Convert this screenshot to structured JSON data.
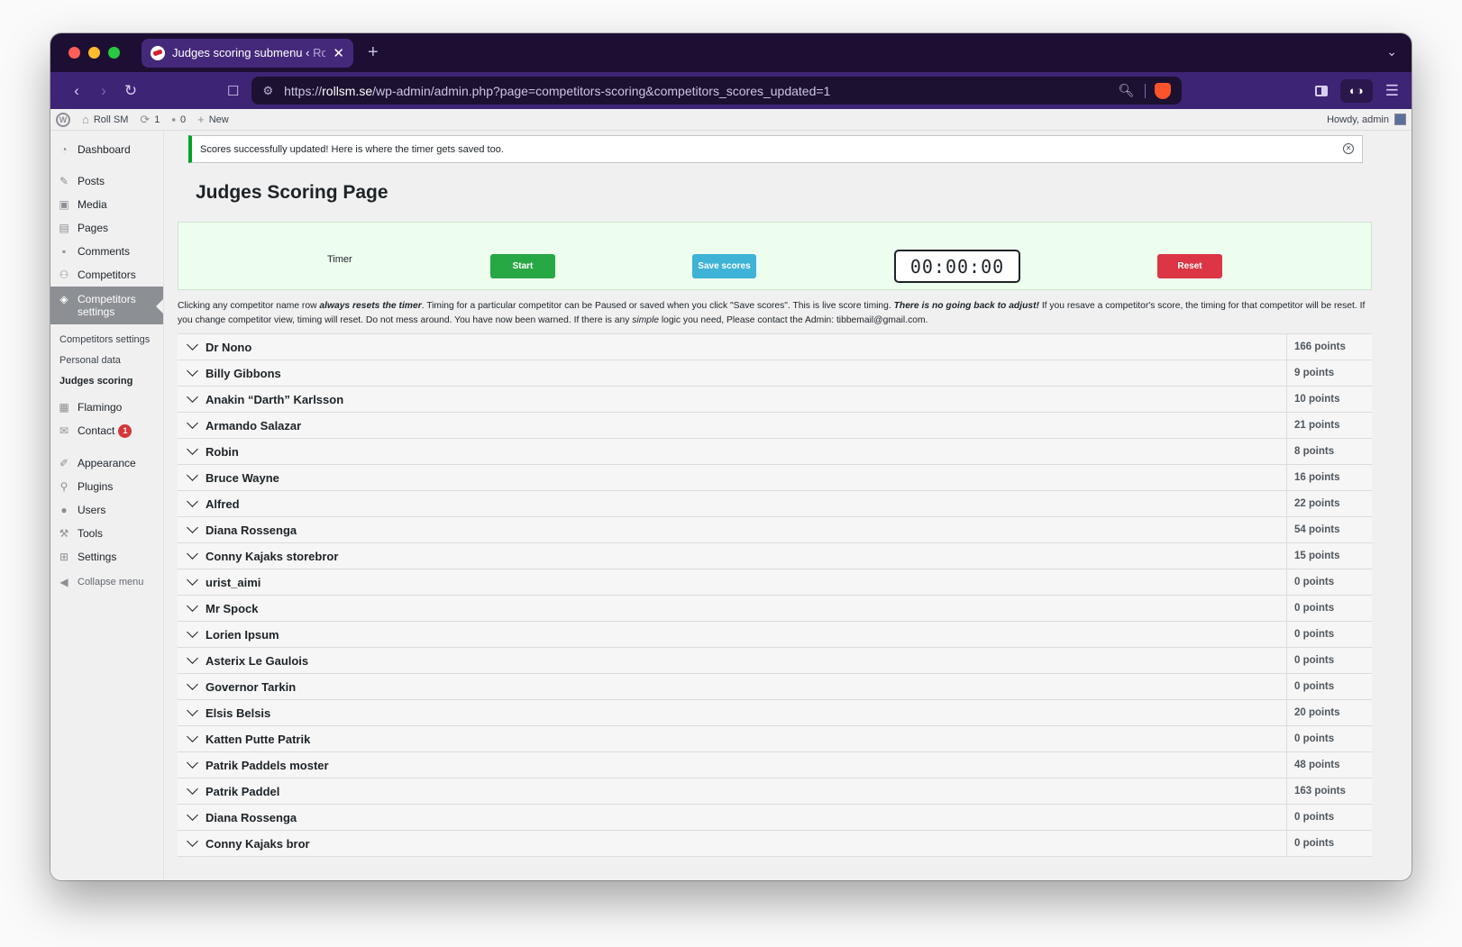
{
  "colors": {
    "tabbar": "#1d0f33",
    "navbar": "#3e2475",
    "start": "#28a745",
    "save": "#3eb3d6",
    "reset": "#dc3545",
    "notice_accent": "#00a32a",
    "traffic": [
      "#ff5f57",
      "#febc2e",
      "#28c840"
    ]
  },
  "browser": {
    "tab_title_main": "Judges scoring submenu ‹ ",
    "tab_title_fade": "Ro",
    "url_scheme": "https://",
    "url_host": "rollsm.se",
    "url_path": "/wp-admin/admin.php?page=competitors-scoring&competitors_scores_updated=1"
  },
  "adminbar": {
    "site": "Roll SM",
    "updates": "1",
    "comments": "0",
    "new": "New",
    "howdy": "Howdy, admin"
  },
  "menu": {
    "dashboard": "Dashboard",
    "posts": "Posts",
    "media": "Media",
    "pages": "Pages",
    "comments": "Comments",
    "competitors": "Competitors",
    "competitors_settings_line1": "Competitors",
    "competitors_settings_line2": "settings",
    "sub_competitors_settings": "Competitors settings",
    "sub_personal_data": "Personal data",
    "sub_judges_scoring": "Judges scoring",
    "flamingo": "Flamingo",
    "contact": "Contact",
    "contact_badge": "1",
    "appearance": "Appearance",
    "plugins": "Plugins",
    "users": "Users",
    "tools": "Tools",
    "settings": "Settings",
    "collapse": "Collapse menu"
  },
  "notice": "Scores successfully updated! Here is where the timer gets saved too.",
  "page_title": "Judges Scoring Page",
  "timer": {
    "label": "Timer",
    "start": "Start",
    "save": "Save scores",
    "clock": "00:00:00",
    "reset": "Reset"
  },
  "warning": {
    "p1": "Clicking any competitor name row ",
    "em1": "always resets the timer",
    "p2": ". Timing for a particular competitor can be Paused or saved when you click \"Save scores\". This is live score timing. ",
    "em2": "There is no going back to adjust!",
    "p3": " If you resave a competitor's score, the timing for that competitor will be reset. If you change competitor view, timing will reset. Do not mess around. You have now been warned. If there is any ",
    "em3": "simple",
    "p4": " logic you need, Please contact the Admin: tibbemail@gmail.com."
  },
  "competitors": [
    {
      "name": "Dr Nono",
      "points": "166 points"
    },
    {
      "name": "Billy Gibbons",
      "points": "9 points"
    },
    {
      "name": "Anakin “Darth” Karlsson",
      "points": "10 points"
    },
    {
      "name": "Armando Salazar",
      "points": "21 points"
    },
    {
      "name": "Robin",
      "points": "8 points"
    },
    {
      "name": "Bruce Wayne",
      "points": "16 points"
    },
    {
      "name": "Alfred",
      "points": "22 points"
    },
    {
      "name": "Diana Rossenga",
      "points": "54 points"
    },
    {
      "name": "Conny Kajaks storebror",
      "points": "15 points"
    },
    {
      "name": "urist_aimi",
      "points": "0 points"
    },
    {
      "name": "Mr Spock",
      "points": "0 points"
    },
    {
      "name": "Lorien Ipsum",
      "points": "0 points"
    },
    {
      "name": "Asterix Le Gaulois",
      "points": "0 points"
    },
    {
      "name": "Governor Tarkin",
      "points": "0 points"
    },
    {
      "name": "Elsis Belsis",
      "points": "20 points"
    },
    {
      "name": "Katten Putte Patrik",
      "points": "0 points"
    },
    {
      "name": "Patrik Paddels moster",
      "points": "48 points"
    },
    {
      "name": "Patrik Paddel",
      "points": "163 points"
    },
    {
      "name": "Diana Rossenga",
      "points": "0 points"
    },
    {
      "name": "Conny Kajaks bror",
      "points": "0 points"
    }
  ]
}
